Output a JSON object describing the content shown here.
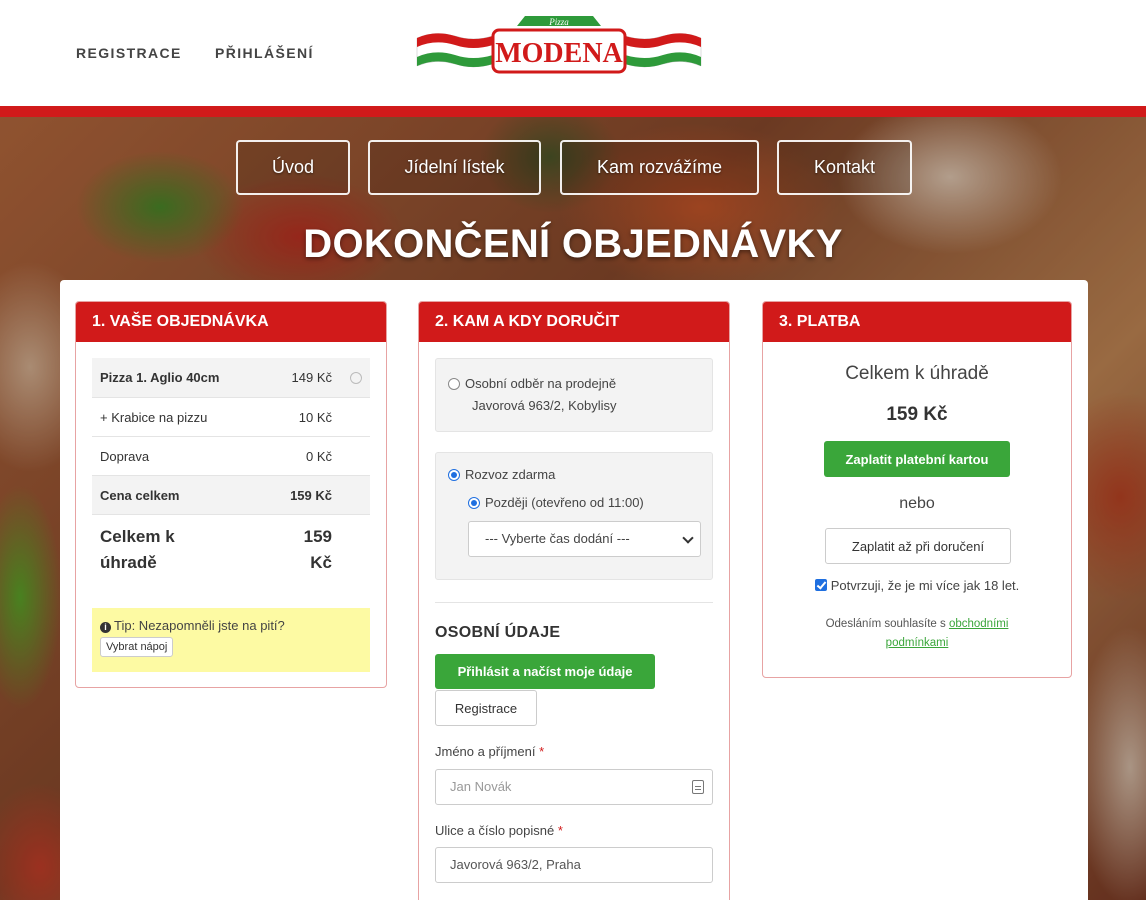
{
  "header": {
    "links": [
      "REGISTRACE",
      "PŘIHLÁŠENÍ"
    ],
    "logo": {
      "brand": "MODENA",
      "small": "Pizza"
    }
  },
  "nav": [
    "Úvod",
    "Jídelní lístek",
    "Kam rozvážíme",
    "Kontakt"
  ],
  "page_title": "DOKONČENÍ OBJEDNÁVKY",
  "order": {
    "heading": "1. VAŠE OBJEDNÁVKA",
    "rows": [
      {
        "label": "Pizza 1. Aglio 40cm",
        "value": "149 Kč"
      },
      {
        "label": "+ Krabice na pizzu",
        "value": "10 Kč"
      },
      {
        "label": "Doprava",
        "value": "0 Kč"
      },
      {
        "label": "Cena celkem",
        "value": "159 Kč"
      }
    ],
    "total_label_1": "Celkem k",
    "total_label_2": "úhradě",
    "total_value_1": "159",
    "total_value_2": "Kč",
    "tip_text": "Tip: Nezapomněli jste na pití?",
    "tip_button": "Vybrat nápoj"
  },
  "delivery": {
    "heading": "2. KAM A KDY DORUČIT",
    "pickup_line1": "Osobní odběr na prodejně",
    "pickup_line2": "Javorová 963/2, Kobylisy",
    "delivery_label": "Rozvoz zdarma",
    "later_label": "Později (otevřeno od 11:00)",
    "time_select": "--- Vyberte čas dodání ---",
    "personal_heading": "OSOBNÍ ÚDAJE",
    "login_button": "Přihlásit a načíst moje údaje",
    "register_button": "Registrace",
    "name_label": "Jméno a příjmení",
    "name_placeholder": "Jan Novák",
    "street_label": "Ulice a číslo popisné",
    "street_value": "Javorová 963/2, Praha",
    "required_mark": "*"
  },
  "payment": {
    "heading": "3. PLATBA",
    "total_label": "Celkem k úhradě",
    "total_value": "159 Kč",
    "pay_card": "Zaplatit platební kartou",
    "or": "nebo",
    "pay_delivery": "Zaplatit až při doručení",
    "age_confirm": "Potvrzuji, že je mi více jak 18 let.",
    "terms_prefix": "Odesláním souhlasíte s",
    "terms_link_1": "obchodními",
    "terms_link_2": "podmínkami"
  },
  "colors": {
    "brand_red": "#d11a1a",
    "green": "#3aa63a",
    "tip_yellow": "#fdfaa3"
  }
}
